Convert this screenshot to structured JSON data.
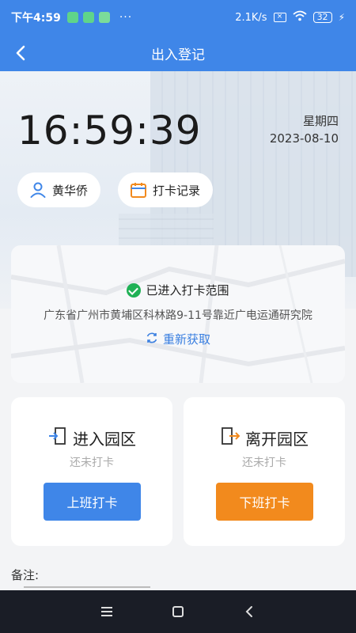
{
  "status_bar": {
    "time": "下午4:59",
    "dots": "···",
    "net_speed": "2.1K/s",
    "battery": "32"
  },
  "nav": {
    "title": "出入登记"
  },
  "clock": {
    "time": "16:59:39",
    "weekday": "星期四",
    "date": "2023-08-10"
  },
  "chips": {
    "user_name": "黄华侨",
    "record_label": "打卡记录"
  },
  "location": {
    "status": "已进入打卡范围",
    "address": "广东省广州市黄埔区科林路9-11号靠近广电运通研究院",
    "refresh_label": "重新获取"
  },
  "enter": {
    "title": "进入园区",
    "status": "还未打卡",
    "button": "上班打卡"
  },
  "leave": {
    "title": "离开园区",
    "status": "还未打卡",
    "button": "下班打卡"
  },
  "remark": {
    "label": "备注:"
  },
  "colors": {
    "primary": "#3f86e8",
    "orange": "#f28a1d",
    "success": "#1fb155"
  }
}
